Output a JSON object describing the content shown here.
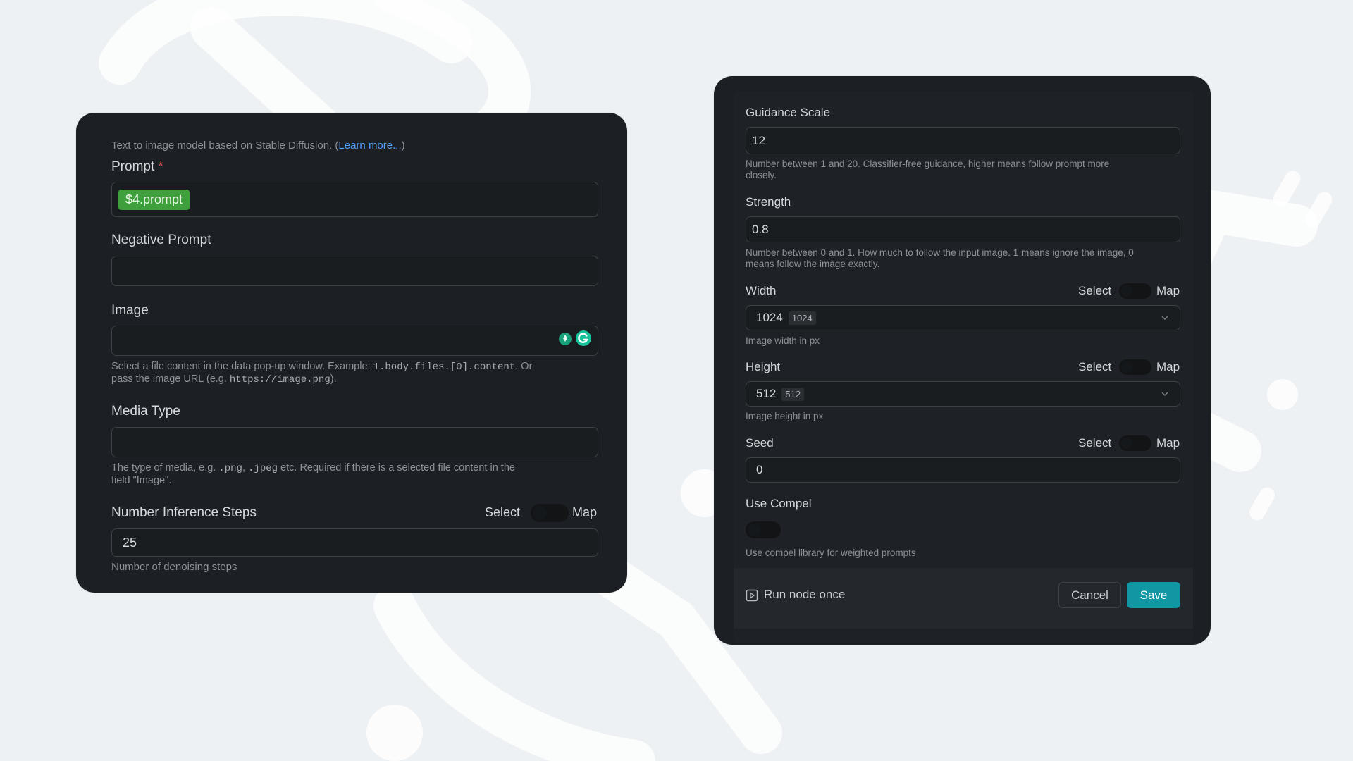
{
  "left_panel": {
    "intro_text": "Text to image model based on Stable Diffusion. (",
    "learn_more": "Learn more...",
    "intro_close": ")",
    "prompt": {
      "label": "Prompt",
      "required_mark": "*",
      "chip": "$4.prompt"
    },
    "negative_prompt": {
      "label": "Negative Prompt",
      "value": ""
    },
    "image": {
      "label": "Image",
      "value": "",
      "helper_1": "Select a file content in the data pop-up window. Example: ",
      "helper_code_1": "1.body.files.[0].content",
      "helper_2": ". Or",
      "helper_3": "pass the image URL (e.g. ",
      "helper_code_2": "https://image.png",
      "helper_4": ")."
    },
    "media_type": {
      "label": "Media Type",
      "value": "",
      "helper_1": "The type of media, e.g. ",
      "code_png": ".png",
      "helper_comma": ", ",
      "code_jpeg": ".jpeg",
      "helper_2": " etc. Required if there is a selected file content in the",
      "helper_3": "field \"Image\"."
    },
    "inference_steps": {
      "label": "Number Inference Steps",
      "select": "Select",
      "map": "Map",
      "value": "25",
      "helper": "Number of denoising steps"
    }
  },
  "right_panel": {
    "guidance_scale": {
      "label": "Guidance Scale",
      "value": "12",
      "helper_1": "Number between 1 and 20. Classifier-free guidance, higher means follow prompt more",
      "helper_2": "closely."
    },
    "strength": {
      "label": "Strength",
      "value": "0.8",
      "helper_1": "Number between 0 and 1. How much to follow the input image. 1 means ignore the image, 0",
      "helper_2": "means follow the image exactly."
    },
    "width": {
      "label": "Width",
      "select": "Select",
      "map": "Map",
      "value": "1024",
      "badge": "1024",
      "helper": "Image width in px"
    },
    "height": {
      "label": "Height",
      "select": "Select",
      "map": "Map",
      "value": "512",
      "badge": "512",
      "helper": "Image height in px"
    },
    "seed": {
      "label": "Seed",
      "select": "Select",
      "map": "Map",
      "value": "0"
    },
    "use_compel": {
      "label": "Use Compel",
      "enabled": false,
      "helper": "Use compel library for weighted prompts"
    },
    "footer": {
      "run_once": "Run node once",
      "cancel": "Cancel",
      "save": "Save"
    }
  },
  "colors": {
    "panel": "#1c1f23",
    "chip": "#3f9f3c",
    "save": "#1196a3",
    "link": "#4ea1ff"
  }
}
